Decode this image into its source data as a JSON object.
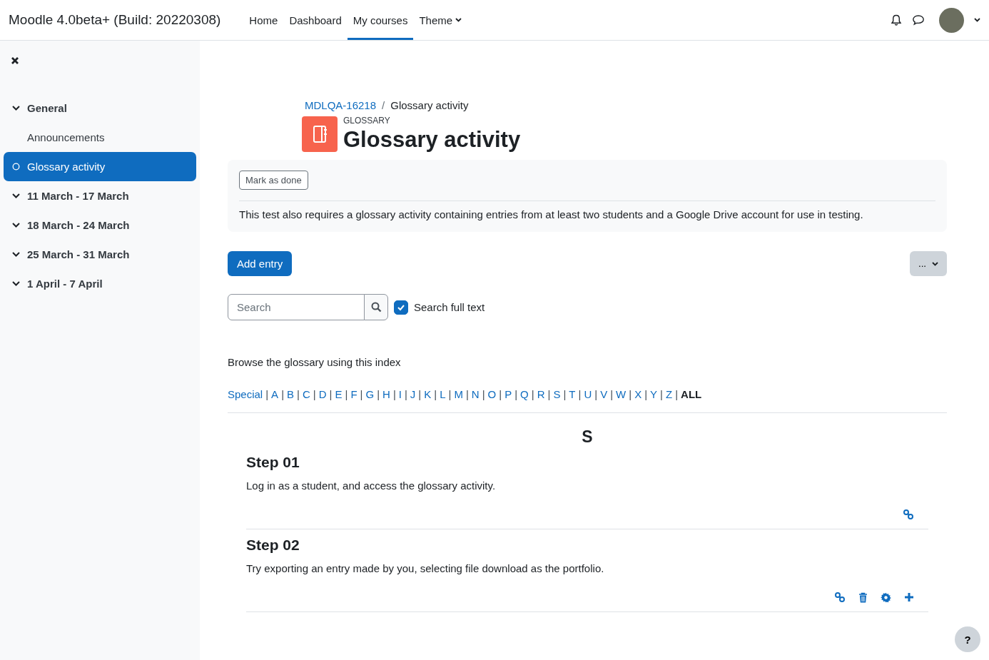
{
  "navbar": {
    "site_name": "Moodle 4.0beta+ (Build: 20220308)",
    "links": [
      {
        "label": "Home",
        "selected": false,
        "dropdown": false
      },
      {
        "label": "Dashboard",
        "selected": false,
        "dropdown": false
      },
      {
        "label": "My courses",
        "selected": true,
        "dropdown": false
      },
      {
        "label": "Theme",
        "selected": false,
        "dropdown": true
      }
    ]
  },
  "sidebar": {
    "items": [
      {
        "kind": "section",
        "label": "General",
        "selected": false
      },
      {
        "kind": "activity",
        "label": "Announcements",
        "selected": false
      },
      {
        "kind": "activity",
        "label": "Glossary activity",
        "selected": true
      },
      {
        "kind": "section",
        "label": "11 March - 17 March",
        "selected": false
      },
      {
        "kind": "section",
        "label": "18 March - 24 March",
        "selected": false
      },
      {
        "kind": "section",
        "label": "25 March - 31 March",
        "selected": false
      },
      {
        "kind": "section",
        "label": "1 April - 7 April",
        "selected": false
      }
    ]
  },
  "breadcrumb": [
    "MDLQA-16218",
    "Glossary activity"
  ],
  "breadcrumb_separator": "/",
  "header": {
    "module": "GLOSSARY",
    "title": "Glossary activity"
  },
  "activity_info": {
    "button": "Mark as done",
    "description": "This test also requires a glossary activity containing entries from at least two students and a Google Drive account for use in testing."
  },
  "add_button": "Add entry",
  "menu_button": "...",
  "search": {
    "placeholder": "Search",
    "full_text_label": "Search full text",
    "full_text_checked": true
  },
  "index": {
    "caption": "Browse the glossary using this index",
    "separator": "|",
    "letters": [
      {
        "label": "Special",
        "selected": false
      },
      {
        "label": "A",
        "selected": false
      },
      {
        "label": "B",
        "selected": false
      },
      {
        "label": "C",
        "selected": false
      },
      {
        "label": "D",
        "selected": false
      },
      {
        "label": "E",
        "selected": false
      },
      {
        "label": "F",
        "selected": false
      },
      {
        "label": "G",
        "selected": false
      },
      {
        "label": "H",
        "selected": false
      },
      {
        "label": "I",
        "selected": false
      },
      {
        "label": "J",
        "selected": false
      },
      {
        "label": "K",
        "selected": false
      },
      {
        "label": "L",
        "selected": false
      },
      {
        "label": "M",
        "selected": false
      },
      {
        "label": "N",
        "selected": false
      },
      {
        "label": "O",
        "selected": false
      },
      {
        "label": "P",
        "selected": false
      },
      {
        "label": "Q",
        "selected": false
      },
      {
        "label": "R",
        "selected": false
      },
      {
        "label": "S",
        "selected": false
      },
      {
        "label": "T",
        "selected": false
      },
      {
        "label": "U",
        "selected": false
      },
      {
        "label": "V",
        "selected": false
      },
      {
        "label": "W",
        "selected": false
      },
      {
        "label": "X",
        "selected": false
      },
      {
        "label": "Y",
        "selected": false
      },
      {
        "label": "Z",
        "selected": false
      },
      {
        "label": "ALL",
        "selected": true
      }
    ]
  },
  "group_letter": "S",
  "entries": [
    {
      "title": "Step 01",
      "text": "Log in as a student, and access the glossary activity.",
      "actions": [
        {
          "kind": "link"
        }
      ]
    },
    {
      "title": "Step 02",
      "text": "Try exporting an entry made by you, selecting file download as the portfolio.",
      "actions": [
        {
          "kind": "link"
        },
        {
          "kind": "delete"
        },
        {
          "kind": "settings"
        },
        {
          "kind": "add"
        }
      ]
    }
  ],
  "help_button": "?"
}
